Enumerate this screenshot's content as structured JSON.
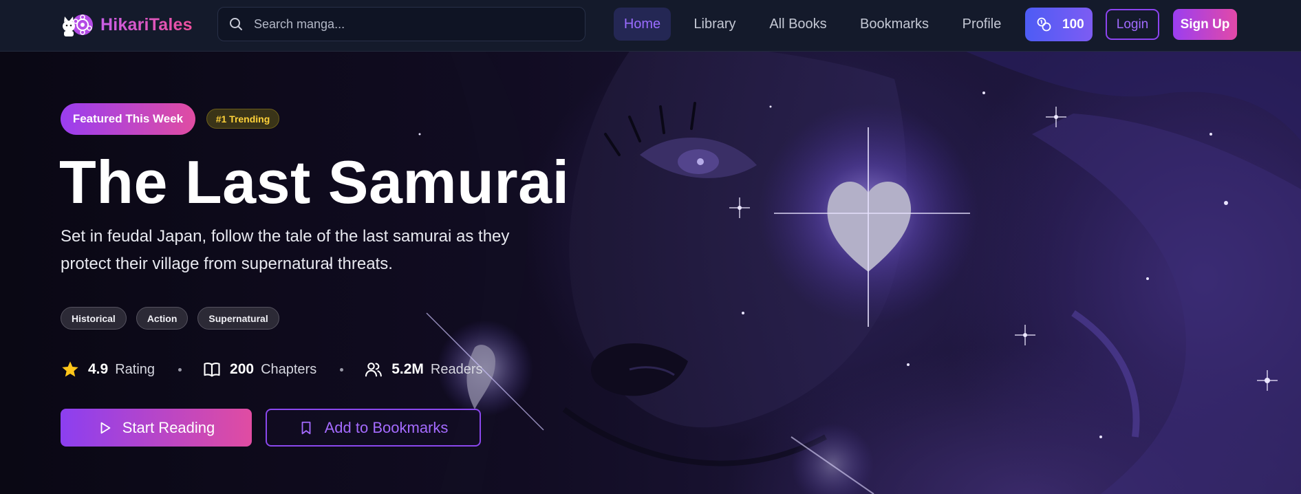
{
  "brand": {
    "name": "HikariTales"
  },
  "search": {
    "placeholder": "Search manga..."
  },
  "nav": {
    "items": [
      {
        "label": "Home",
        "active": true
      },
      {
        "label": "Library",
        "active": false
      },
      {
        "label": "All Books",
        "active": false
      },
      {
        "label": "Bookmarks",
        "active": false
      },
      {
        "label": "Profile",
        "active": false
      }
    ],
    "coins": "100",
    "login_label": "Login",
    "signup_label": "Sign Up"
  },
  "hero": {
    "badge_featured": "Featured This Week",
    "badge_trending": "#1 Trending",
    "title": "The Last Samurai",
    "description": "Set in feudal Japan, follow the tale of the last samurai as they protect their village from supernatural threats.",
    "genres": [
      "Historical",
      "Action",
      "Supernatural"
    ],
    "stats": {
      "rating": {
        "value": "4.9",
        "label": "Rating",
        "icon": "star-icon"
      },
      "chapters": {
        "value": "200",
        "label": "Chapters",
        "icon": "book-icon"
      },
      "readers": {
        "value": "5.2M",
        "label": "Readers",
        "icon": "users-icon"
      }
    },
    "start_label": "Start Reading",
    "bookmark_label": "Add to Bookmarks"
  },
  "colors": {
    "accent_purple": "#8c3ff0",
    "accent_pink": "#e04ca2",
    "trending_yellow": "#ffd23a",
    "star_yellow": "#ffc61a"
  }
}
